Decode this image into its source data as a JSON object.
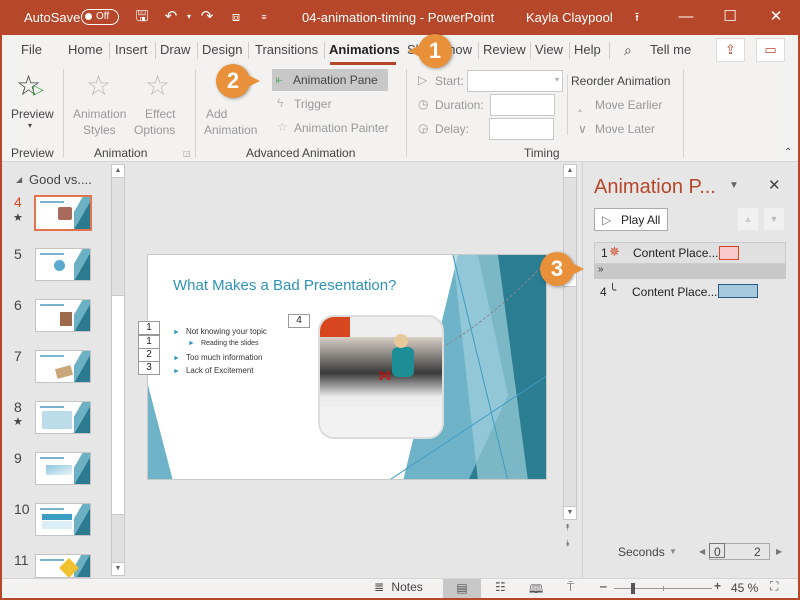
{
  "titlebar": {
    "autosave_label": "AutoSave",
    "autosave_state": "Off",
    "document_title": "04-animation-timing  -  PowerPoint",
    "user_name": "Kayla Claypool",
    "icons": [
      "save-icon",
      "undo-icon",
      "redo-icon",
      "start-slideshow-icon",
      "customize-qat-icon",
      "ribbon-display-options-icon",
      "minimize-icon",
      "maximize-icon",
      "close-icon"
    ]
  },
  "tabs": {
    "items": [
      "File",
      "Home",
      "Insert",
      "Draw",
      "Design",
      "Transitions",
      "Animations",
      "Slide Show",
      "Review",
      "View",
      "Help"
    ],
    "active": "Animations",
    "tell_me": "Tell me"
  },
  "ribbon": {
    "preview": {
      "label": "Preview",
      "group": "Preview"
    },
    "animation_group": {
      "styles": "Animation Styles",
      "styles_line1": "Animation",
      "styles_line2": "Styles",
      "effect_line1": "Effect",
      "effect_line2": "Options",
      "group": "Animation"
    },
    "advanced": {
      "add_line1": "Add",
      "add_line2": "Animation",
      "animation_pane": "Animation Pane",
      "trigger": "Trigger",
      "painter": "Animation Painter",
      "group": "Advanced Animation"
    },
    "timing": {
      "start": "Start:",
      "duration": "Duration:",
      "delay": "Delay:",
      "start_value": "",
      "duration_value": "",
      "delay_value": "",
      "group": "Timing"
    },
    "reorder": {
      "title": "Reorder Animation",
      "earlier": "Move Earlier",
      "later": "Move Later"
    }
  },
  "thumbnails": {
    "section": "Good vs....",
    "slides": [
      {
        "num": "4",
        "star": true,
        "selected": true
      },
      {
        "num": "5",
        "star": false,
        "selected": false
      },
      {
        "num": "6",
        "star": false,
        "selected": false
      },
      {
        "num": "7",
        "star": false,
        "selected": false
      },
      {
        "num": "8",
        "star": true,
        "selected": false
      },
      {
        "num": "9",
        "star": false,
        "selected": false
      },
      {
        "num": "10",
        "star": false,
        "selected": false
      },
      {
        "num": "11",
        "star": false,
        "selected": false
      }
    ]
  },
  "slide": {
    "title": "What Makes a Bad Presentation?",
    "bullets": [
      {
        "tag": "1",
        "text": "Not knowing your topic",
        "level": 1
      },
      {
        "tag": "1",
        "text": "Reading the slides",
        "level": 2
      },
      {
        "tag": "2",
        "text": "Too much information",
        "level": 1
      },
      {
        "tag": "3",
        "text": "Lack of Excitement",
        "level": 1
      }
    ],
    "picture_tag": "4"
  },
  "animation_pane": {
    "title": "Animation P...",
    "play_all": "Play All",
    "items": [
      {
        "order": "1",
        "label": "Content Place...",
        "color": "#f9c8c8",
        "border": "#d24726"
      },
      {
        "order": "4",
        "label": "Content Place...",
        "color": "#a7c9df",
        "border": "#2b5b83"
      }
    ],
    "seconds_label": "Seconds",
    "timeline_start": "0",
    "timeline_end": "2"
  },
  "statusbar": {
    "notes": "Notes",
    "zoom": "45 %",
    "zoom_level_percent": 45
  },
  "callouts": [
    "1",
    "2",
    "3"
  ],
  "colors": {
    "accent": "#b7472a",
    "callout": "#e8913a",
    "slide_title": "#2e93b8"
  }
}
